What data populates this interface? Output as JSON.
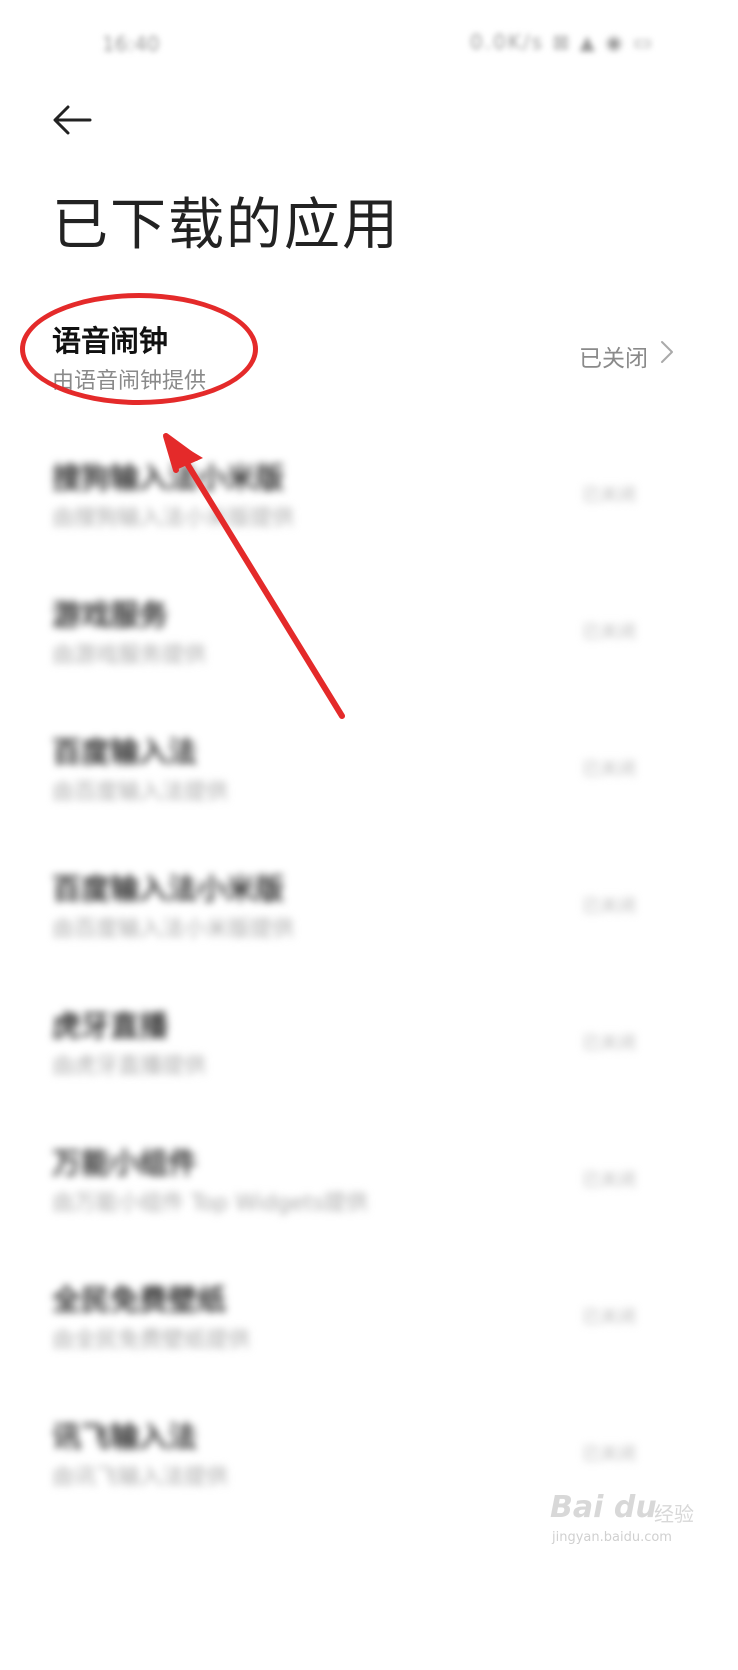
{
  "status_bar": {
    "time": "16:40",
    "icons": "0.0K/s ⊠ ▲ ◉ ▭"
  },
  "header": {
    "back_icon": "arrow-left-icon",
    "title": "已下载的应用"
  },
  "apps": [
    {
      "name": "语音闹钟",
      "sub": "由语音闹钟提供",
      "status": "已关闭"
    },
    {
      "name": "搜狗输入法小米版",
      "sub": "由搜狗输入法小米版提供",
      "status": "已关闭"
    },
    {
      "name": "游戏服务",
      "sub": "由游戏服务提供",
      "status": "已关闭"
    },
    {
      "name": "百度输入法",
      "sub": "由百度输入法提供",
      "status": "已关闭"
    },
    {
      "name": "百度输入法小米版",
      "sub": "由百度输入法小米版提供",
      "status": "已关闭"
    },
    {
      "name": "虎牙直播",
      "sub": "由虎牙直播提供",
      "status": "已关闭"
    },
    {
      "name": "万能小组件",
      "sub": "由万能小组件 Top Widgets提供",
      "status": "已关闭"
    },
    {
      "name": "全民免费壁纸",
      "sub": "由全民免费壁纸提供",
      "status": "已关闭"
    },
    {
      "name": "讯飞输入法",
      "sub": "由讯飞输入法提供",
      "status": "已关闭"
    },
    {
      "name": "",
      "sub": "",
      "status": ""
    }
  ],
  "watermark": {
    "logo": "Bai du",
    "text": "经验",
    "url": "jingyan.baidu.com"
  },
  "annotation_color": "#e42a2a"
}
